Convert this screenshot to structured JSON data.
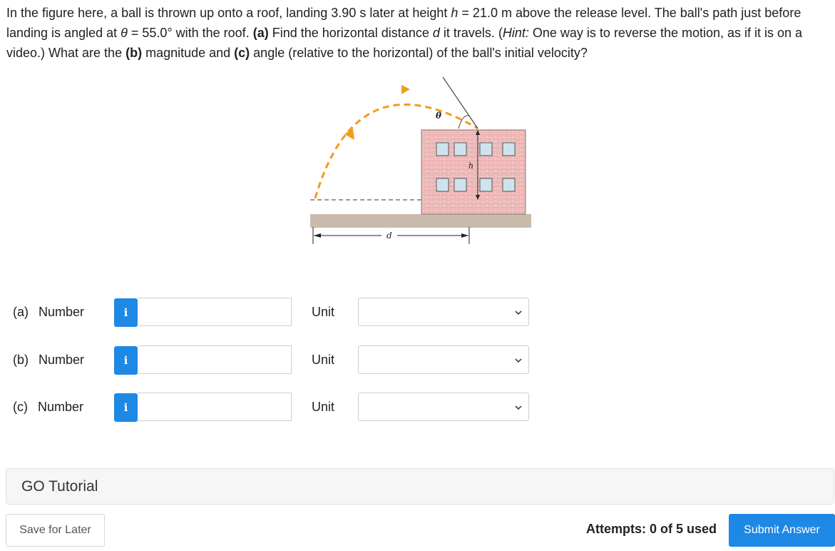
{
  "question": {
    "t1": "In the figure here, a ball is thrown up onto a roof, landing 3.90 s later at height ",
    "t2": "h",
    "t3": " = 21.0 m above the release level. The ball's path just before landing is angled at ",
    "t4": "θ",
    "t5": " = 55.0° with the roof. ",
    "t6": "(a)",
    "t7": " Find the horizontal distance ",
    "t8": "d",
    "t9": " it travels. (",
    "t10": "Hint:",
    "t11": " One way is to reverse the motion, as if it is on a video.) What are the ",
    "t12": "(b)",
    "t13": " magnitude and ",
    "t14": "(c)",
    "t15": " angle (relative to the horizontal) of the ball's initial velocity?"
  },
  "figure": {
    "theta_label": "θ",
    "h_label": "h",
    "d_label": "d"
  },
  "answers": [
    {
      "part": "(a)",
      "label": "Number",
      "info": "i",
      "value": "",
      "unit_label": "Unit",
      "unit_value": ""
    },
    {
      "part": "(b)",
      "label": "Number",
      "info": "i",
      "value": "",
      "unit_label": "Unit",
      "unit_value": ""
    },
    {
      "part": "(c)",
      "label": "Number",
      "info": "i",
      "value": "",
      "unit_label": "Unit",
      "unit_value": ""
    }
  ],
  "tutorial": {
    "label": "GO Tutorial"
  },
  "footer": {
    "save_label": "Save for Later",
    "attempts": "Attempts: 0 of 5 used",
    "submit_label": "Submit Answer"
  },
  "colors": {
    "accent": "#1e88e5",
    "brick": "#e9a9a9",
    "ground": "#c8b8a8",
    "trajectory": "#f29b1e"
  },
  "icons": {
    "info": "info-icon",
    "chevron": "chevron-down-icon"
  }
}
